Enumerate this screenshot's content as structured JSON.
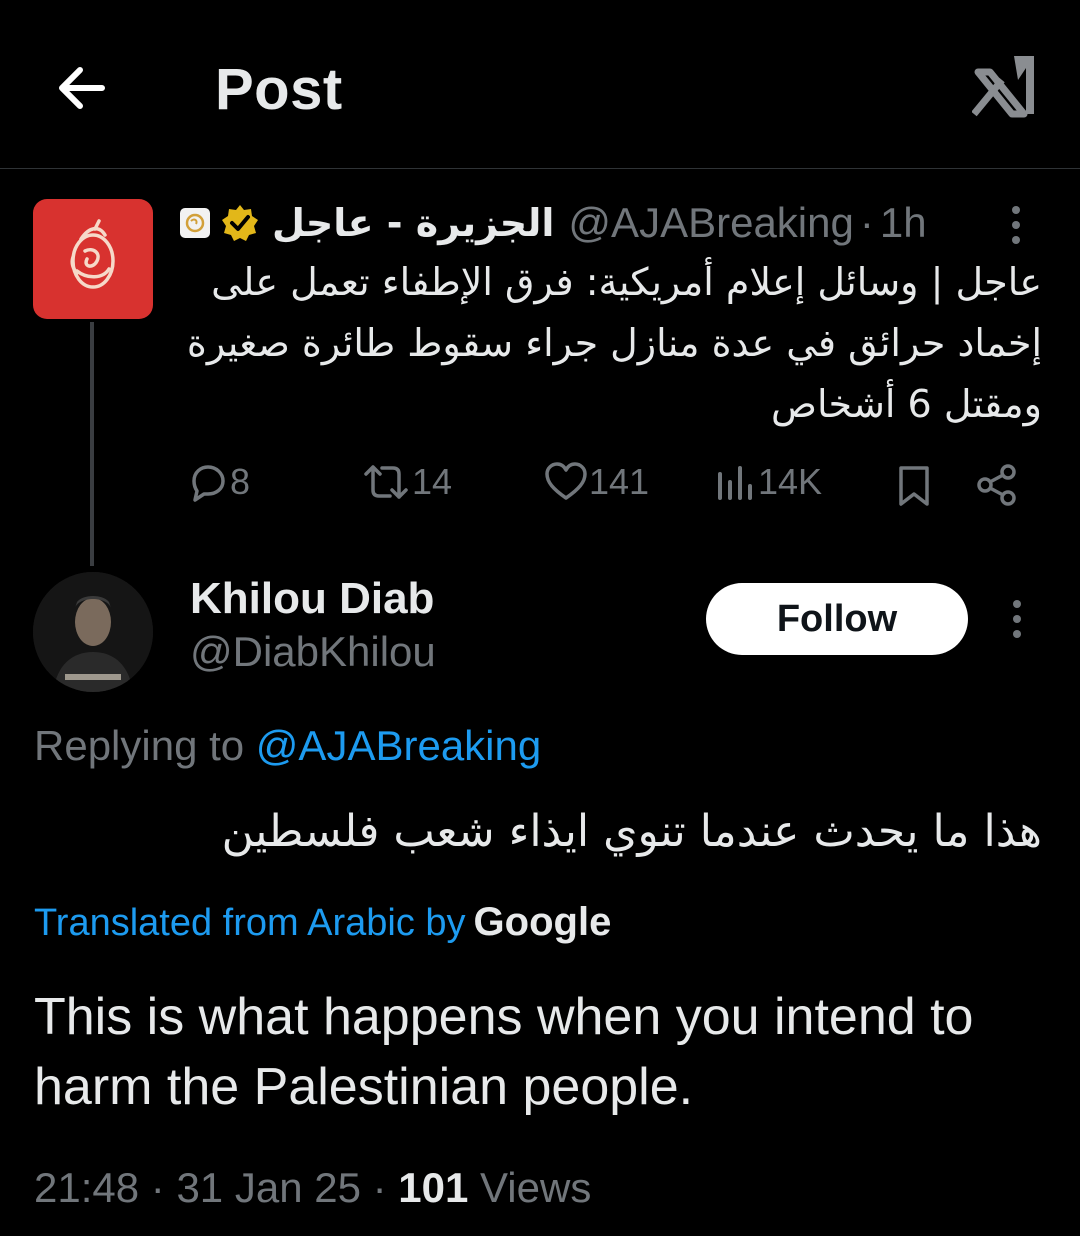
{
  "header": {
    "title": "Post",
    "back_icon": "arrow-left-icon",
    "logo_icon": "x-logo-icon"
  },
  "parent_post": {
    "name": "الجزيرة - عاجل",
    "handle": "@AJABreaking",
    "time": "1h",
    "separator": "·",
    "text": "عاجل | وسائل إعلام أمريكية: فرق الإطفاء تعمل على إخماد حرائق في عدة منازل جراء سقوط طائرة صغيرة ومقتل 6 أشخاص",
    "stats": {
      "replies": "8",
      "reposts": "14",
      "likes": "141",
      "views": "14K"
    }
  },
  "reply": {
    "name": "Khilou Diab",
    "handle": "@DiabKhilou",
    "follow_label": "Follow",
    "replying_prefix": "Replying to",
    "replying_to": "@AJABreaking",
    "text_arabic": "هذا ما يحدث عندما تنوي ايذاء شعب فلسطين",
    "translated_label": "Translated from Arabic by",
    "translated_by": "Google",
    "text_english": "This is what happens when you intend to harm the Palestinian people.",
    "time": "21:48",
    "date": "31 Jan 25",
    "views_count": "101",
    "views_label": "Views",
    "separator": "·"
  },
  "colors": {
    "background": "#000000",
    "text": "#e7e9ea",
    "secondary": "#71767b",
    "link": "#1d9bf0",
    "verified": "#e2b719",
    "aja_brand": "#d8322f"
  }
}
